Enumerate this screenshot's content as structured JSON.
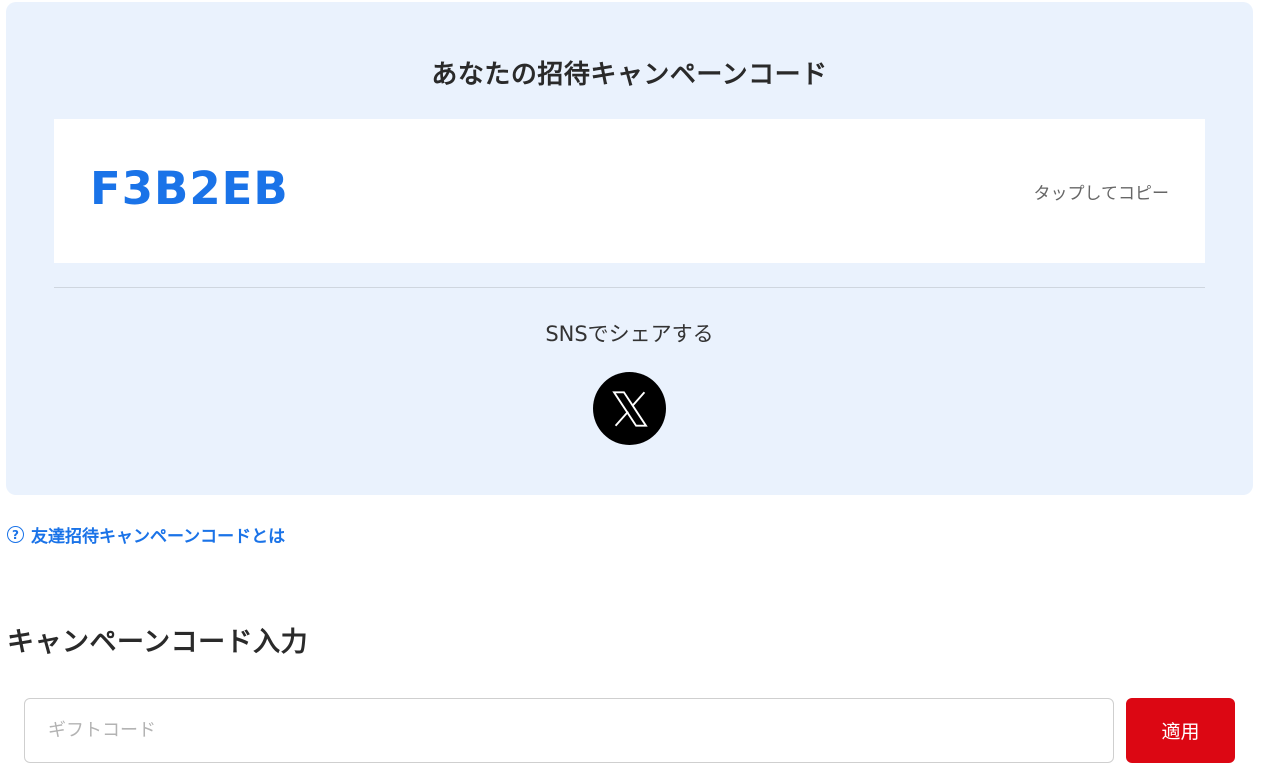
{
  "invite": {
    "title": "あなたの招待キャンペーンコード",
    "code": "F3B2EB",
    "copy_label": "タップしてコピー",
    "sns_label": "SNSでシェアする",
    "share_icon": "x-logo-icon"
  },
  "help": {
    "icon": "question-circle-icon",
    "icon_glyph": "?",
    "link_text": "友達招待キャンペーンコードとは"
  },
  "campaign_input": {
    "heading": "キャンペーンコード入力",
    "placeholder": "ギフトコード",
    "value": "",
    "apply_label": "適用"
  },
  "colors": {
    "panel_bg": "#eaf2fd",
    "code_color": "#1a73e8",
    "link_color": "#1a73e8",
    "apply_bg": "#dc0713"
  }
}
